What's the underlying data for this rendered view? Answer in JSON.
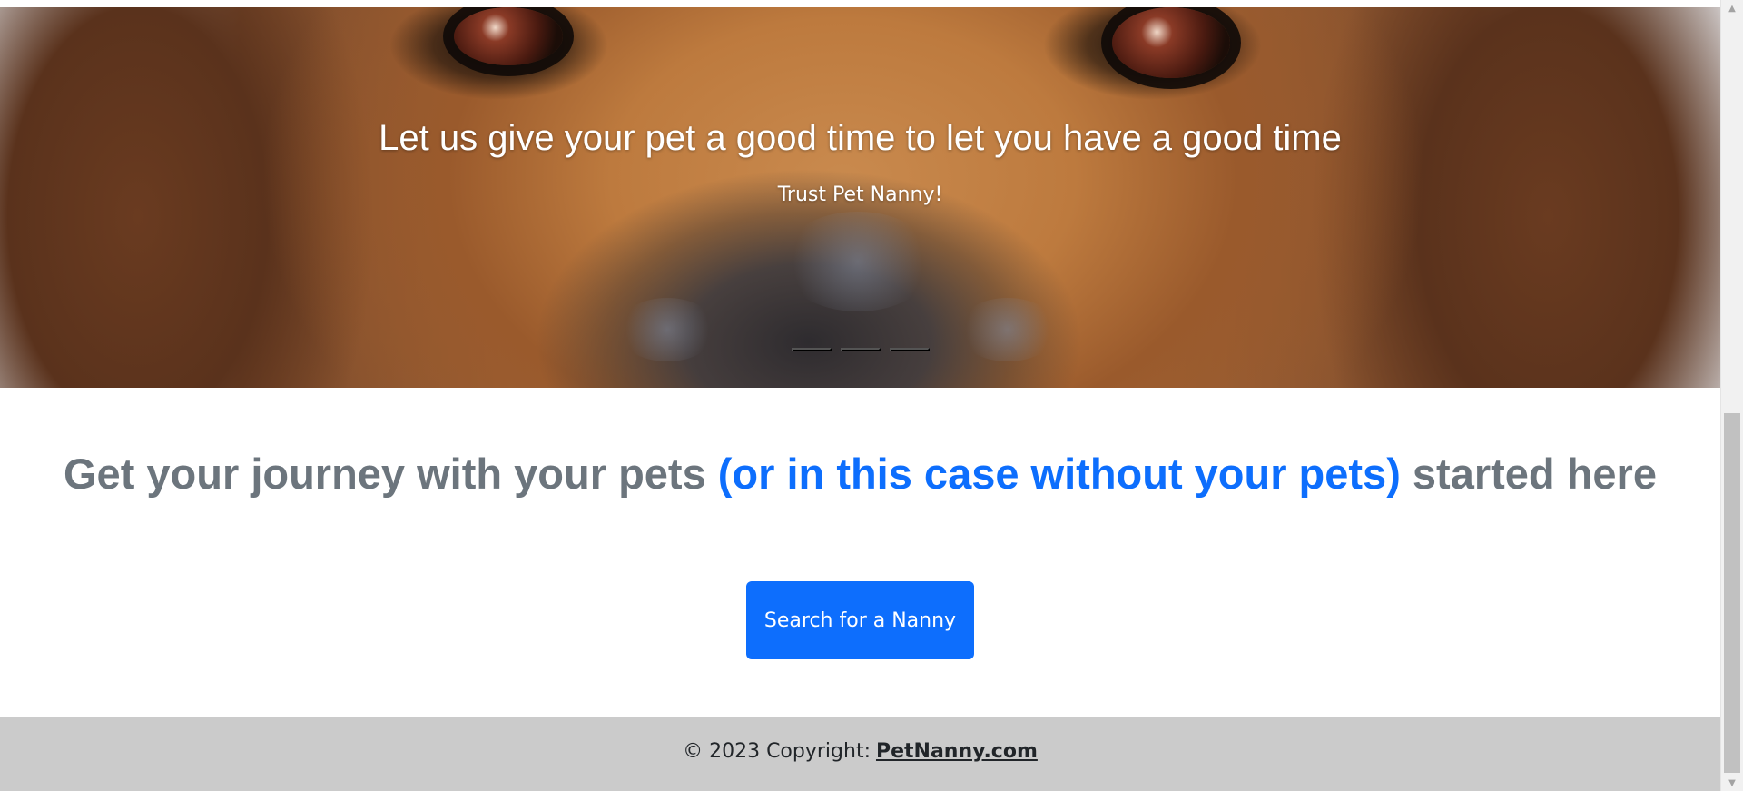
{
  "hero": {
    "title": "Let us give your pet a good time to let you have a good time",
    "subtitle": "Trust Pet Nanny!",
    "slides": 3,
    "active_slide": 1
  },
  "tagline": {
    "before": "Get your journey with your pets ",
    "highlight": "(or in this case without your pets)",
    "after": " started here"
  },
  "cta": {
    "label": "Search for a Nanny"
  },
  "footer": {
    "copyright": "© 2023 Copyright:",
    "link": "PetNanny.com"
  },
  "colors": {
    "primary": "#0d6efd",
    "muted_text": "#6c757d",
    "footer_bg": "#cbcbcb"
  },
  "icons": {
    "scroll_up": "triangle-up-icon",
    "scroll_down": "triangle-down-icon"
  }
}
